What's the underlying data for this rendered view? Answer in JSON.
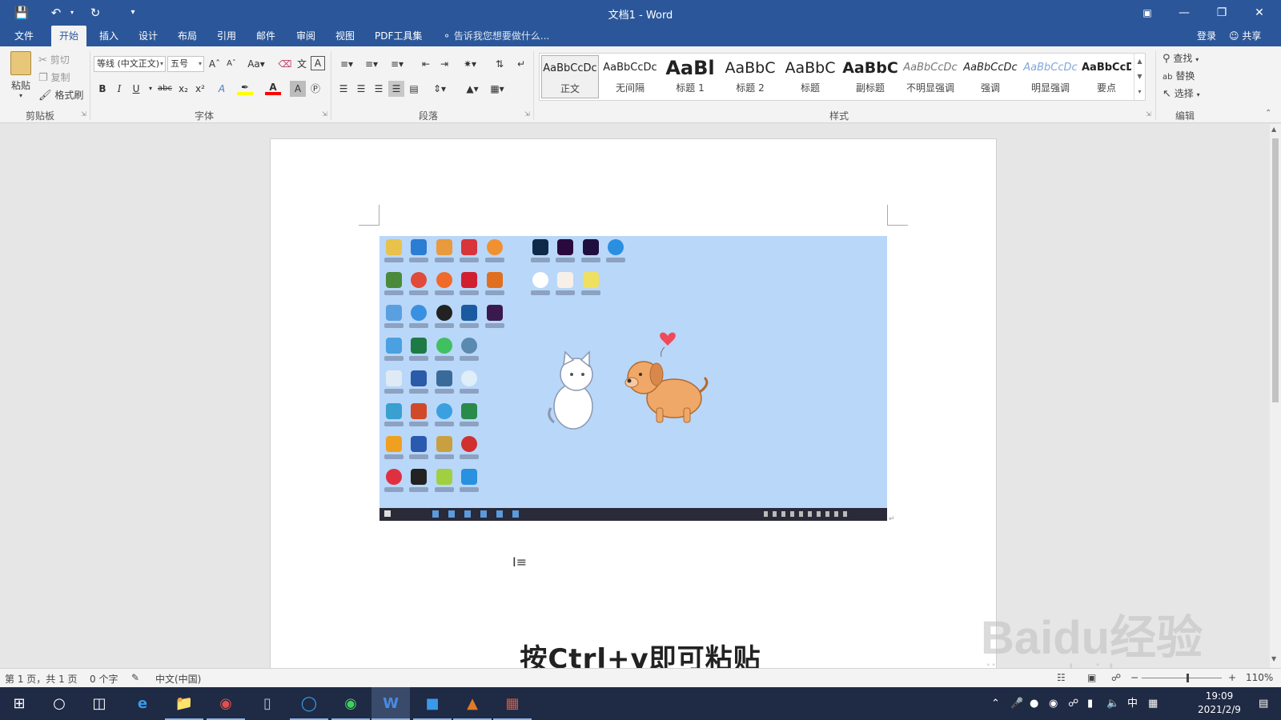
{
  "window": {
    "title": "文档1 - Word",
    "quick_access": [
      "save-icon",
      "undo-icon",
      "redo-icon",
      "customize-icon"
    ]
  },
  "tabs": [
    "文件",
    "开始",
    "插入",
    "设计",
    "布局",
    "引用",
    "邮件",
    "审阅",
    "视图",
    "PDF工具集"
  ],
  "active_tab": "开始",
  "tell_me": "告诉我您想要做什么...",
  "account": {
    "login": "登录",
    "share": "共享"
  },
  "clipboard": {
    "paste": "粘贴",
    "cut": "剪切",
    "copy": "复制",
    "format_painter": "格式刷",
    "label": "剪贴板"
  },
  "font": {
    "name": "等线 (中文正文)",
    "size": "五号",
    "label": "字体"
  },
  "paragraph": {
    "label": "段落"
  },
  "styles": {
    "label": "样式",
    "items": [
      {
        "sample": "AaBbCcDc",
        "name": "正文"
      },
      {
        "sample": "AaBbCcDc",
        "name": "无间隔"
      },
      {
        "sample": "AaBl",
        "name": "标题 1"
      },
      {
        "sample": "AaBbC",
        "name": "标题 2"
      },
      {
        "sample": "AaBbC",
        "name": "标题"
      },
      {
        "sample": "AaBbC",
        "name": "副标题"
      },
      {
        "sample": "AaBbCcDc",
        "name": "不明显强调"
      },
      {
        "sample": "AaBbCcDc",
        "name": "强调"
      },
      {
        "sample": "AaBbCcDc",
        "name": "明显强调"
      },
      {
        "sample": "AaBbCcD",
        "name": "要点"
      }
    ]
  },
  "editing": {
    "find": "查找",
    "replace": "替换",
    "select": "选择",
    "label": "编辑"
  },
  "caption": "按Ctrl+v即可粘贴",
  "watermark": {
    "brand": "Baidu经验",
    "url": "jingyan.baidu.com"
  },
  "status": {
    "page": "第 1 页，共 1 页",
    "words": "0 个字",
    "language": "中文(中国)",
    "zoom": "110%"
  },
  "taskbar": {
    "tray_ime": "中",
    "time": "19:09",
    "date": "2021/2/9"
  },
  "colors": {
    "brand": "#2b579a",
    "highlight": "#ffff00",
    "font_color": "#ff0000",
    "desktop_bg": "#b9d7f9"
  }
}
